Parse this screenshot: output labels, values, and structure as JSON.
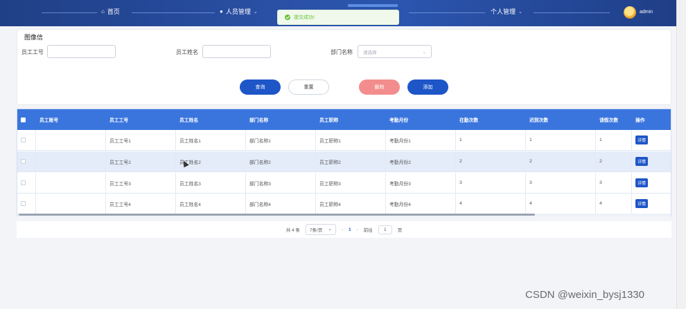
{
  "nav": {
    "home": "首页",
    "staff": "人员管理",
    "personal": "个人管理",
    "user": "admin"
  },
  "toast": {
    "message": "提交成功!",
    "color": "#67c23a"
  },
  "search": {
    "title": "图像信",
    "emp_no_label": "员工工号",
    "emp_name_label": "员工姓名",
    "dept_label": "部门名称",
    "dept_placeholder": "请选择",
    "query": "查询",
    "reset": "重置",
    "delete": "删除",
    "add": "添加"
  },
  "table": {
    "headers": [
      "员工账号",
      "员工工号",
      "员工姓名",
      "部门名称",
      "员工职称",
      "考勤月份",
      "在勤次数",
      "迟到次数",
      "请假次数",
      "操作"
    ],
    "detail": "详情",
    "rows": [
      [
        "",
        "员工工号1",
        "员工姓名1",
        "部门名称1",
        "员工职称1",
        "考勤月份1",
        "1",
        "1",
        "1"
      ],
      [
        "",
        "员工工号2",
        "员工姓名2",
        "部门名称2",
        "员工职称2",
        "考勤月份2",
        "2",
        "2",
        "2"
      ],
      [
        "",
        "员工工号3",
        "员工姓名3",
        "部门名称3",
        "员工职称3",
        "考勤月份3",
        "3",
        "3",
        "3"
      ],
      [
        "",
        "员工工号4",
        "员工姓名4",
        "部门名称4",
        "员工职称4",
        "考勤月份4",
        "4",
        "4",
        "4"
      ]
    ]
  },
  "pager": {
    "total": "共 4 条",
    "size": "7条/页",
    "prev": "‹",
    "page": "1",
    "next": "›",
    "goto": "前往",
    "goto_value": "1",
    "page_unit": "页"
  },
  "watermark": "CSDN @weixin_bysj1330",
  "colors": {
    "primary": "#1e56c8",
    "header": "#3a75de",
    "danger": "#f38d8d"
  }
}
